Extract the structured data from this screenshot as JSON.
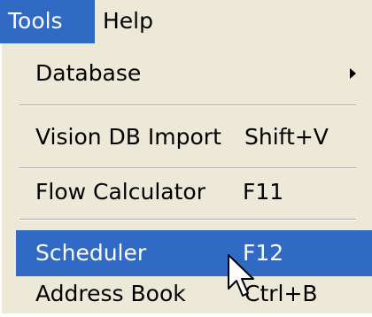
{
  "menubar": {
    "items": [
      {
        "label": "Tools",
        "active": true
      },
      {
        "label": "Help",
        "active": false
      }
    ]
  },
  "dropdown": {
    "items": [
      {
        "label": "Database",
        "shortcut": "",
        "has_submenu": true,
        "highlighted": false
      },
      {
        "label": "Vision DB Import",
        "shortcut": "Shift+V",
        "has_submenu": false,
        "highlighted": false
      },
      {
        "label": "Flow Calculator",
        "shortcut": "F11",
        "has_submenu": false,
        "highlighted": false
      },
      {
        "label": "Scheduler",
        "shortcut": "F12",
        "has_submenu": false,
        "highlighted": true
      },
      {
        "label": "Address Book",
        "shortcut": "Ctrl+B",
        "has_submenu": false,
        "highlighted": false
      }
    ]
  },
  "colors": {
    "menu_background": "#ece9d8",
    "highlight": "#316ac5",
    "highlight_text": "#ffffff",
    "separator_dark": "#aca899"
  },
  "icons": {
    "submenu": "chevron-right-icon",
    "pointer": "mouse-cursor-icon"
  }
}
